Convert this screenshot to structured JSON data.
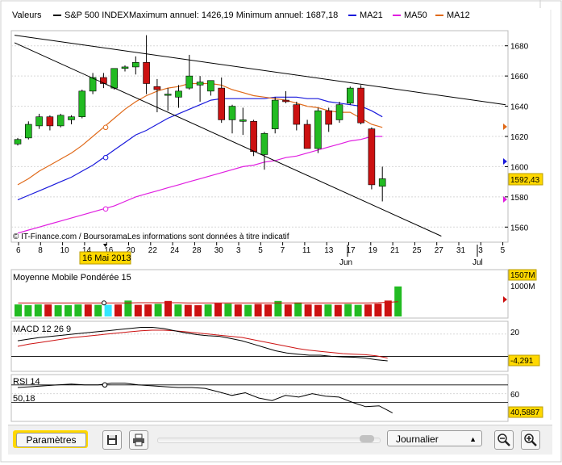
{
  "header": {
    "valeurs_label": "Valeurs",
    "index_name": "S&P 500 INDEX",
    "max_min_text": "Maximum annuel: 1426,19 Minimum annuel: 1687,18",
    "legend": [
      {
        "name": "MA21",
        "color": "#1a1adc"
      },
      {
        "name": "MA50",
        "color": "#e01ee0"
      },
      {
        "name": "MA12",
        "color": "#e06a1a"
      }
    ]
  },
  "copyright": "© IT-Finance.com / BoursoramaLes informations sont données à titre indicatif",
  "date_highlight": "16 Mai 2013",
  "price_badge": "1592,43",
  "colors": {
    "up": "#22bb22",
    "down": "#cc1111",
    "highlight": "#ffd800",
    "trendline": "#000000"
  },
  "chart_data": [
    {
      "type": "candlestick",
      "ylim": [
        1550,
        1690
      ],
      "y_ticks": [
        "1560",
        "1580",
        "1600",
        "1620",
        "1640",
        "1660",
        "1680"
      ],
      "x_tick_labels": [
        "6",
        "8",
        "10",
        "14",
        "16",
        "20",
        "22",
        "24",
        "28",
        "30",
        "3",
        "5",
        "7",
        "11",
        "13",
        "17",
        "19",
        "21",
        "25",
        "27",
        "31",
        "3",
        "5"
      ],
      "x_month_labels": [
        "Jun",
        "Jul"
      ],
      "candles": [
        {
          "o": 1615,
          "h": 1619,
          "l": 1614,
          "c": 1618
        },
        {
          "o": 1619,
          "h": 1630,
          "l": 1618,
          "c": 1628
        },
        {
          "o": 1627,
          "h": 1635,
          "l": 1625,
          "c": 1633
        },
        {
          "o": 1633,
          "h": 1634,
          "l": 1624,
          "c": 1627
        },
        {
          "o": 1627,
          "h": 1635,
          "l": 1626,
          "c": 1634
        },
        {
          "o": 1631,
          "h": 1634,
          "l": 1628,
          "c": 1633
        },
        {
          "o": 1633,
          "h": 1651,
          "l": 1632,
          "c": 1650
        },
        {
          "o": 1650,
          "h": 1662,
          "l": 1648,
          "c": 1659
        },
        {
          "o": 1659,
          "h": 1662,
          "l": 1652,
          "c": 1655
        },
        {
          "o": 1652,
          "h": 1665,
          "l": 1651,
          "c": 1665
        },
        {
          "o": 1665,
          "h": 1667,
          "l": 1663,
          "c": 1666
        },
        {
          "o": 1666,
          "h": 1673,
          "l": 1661,
          "c": 1669
        },
        {
          "o": 1669,
          "h": 1687,
          "l": 1648,
          "c": 1655
        },
        {
          "o": 1653,
          "h": 1658,
          "l": 1636,
          "c": 1651
        },
        {
          "o": 1648,
          "h": 1652,
          "l": 1637,
          "c": 1648
        },
        {
          "o": 1646,
          "h": 1654,
          "l": 1639,
          "c": 1650
        },
        {
          "o": 1652,
          "h": 1674,
          "l": 1651,
          "c": 1660
        },
        {
          "o": 1654,
          "h": 1660,
          "l": 1643,
          "c": 1656
        },
        {
          "o": 1650,
          "h": 1657,
          "l": 1647,
          "c": 1657
        },
        {
          "o": 1652,
          "h": 1659,
          "l": 1629,
          "c": 1631
        },
        {
          "o": 1631,
          "h": 1641,
          "l": 1622,
          "c": 1640
        },
        {
          "o": 1630,
          "h": 1639,
          "l": 1621,
          "c": 1631
        },
        {
          "o": 1630,
          "h": 1631,
          "l": 1607,
          "c": 1610
        },
        {
          "o": 1608,
          "h": 1623,
          "l": 1598,
          "c": 1622
        },
        {
          "o": 1625,
          "h": 1646,
          "l": 1622,
          "c": 1644
        },
        {
          "o": 1644,
          "h": 1650,
          "l": 1642,
          "c": 1643
        },
        {
          "o": 1641,
          "h": 1643,
          "l": 1624,
          "c": 1628
        },
        {
          "o": 1628,
          "h": 1631,
          "l": 1613,
          "c": 1612
        },
        {
          "o": 1612,
          "h": 1639,
          "l": 1609,
          "c": 1637
        },
        {
          "o": 1637,
          "h": 1639,
          "l": 1623,
          "c": 1628
        },
        {
          "o": 1631,
          "h": 1643,
          "l": 1629,
          "c": 1641
        },
        {
          "o": 1642,
          "h": 1653,
          "l": 1641,
          "c": 1652
        },
        {
          "o": 1652,
          "h": 1654,
          "l": 1628,
          "c": 1629
        },
        {
          "o": 1625,
          "h": 1626,
          "l": 1585,
          "c": 1588
        },
        {
          "o": 1587,
          "h": 1600,
          "l": 1577,
          "c": 1592
        }
      ],
      "ma12": [
        1588,
        1592,
        1597,
        1601,
        1605,
        1609,
        1614,
        1620,
        1626,
        1632,
        1638,
        1643,
        1647,
        1650,
        1652,
        1653,
        1655,
        1655,
        1655,
        1654,
        1651,
        1649,
        1647,
        1646,
        1645,
        1644,
        1642,
        1640,
        1639,
        1637,
        1636,
        1636,
        1632,
        1628,
        1626
      ],
      "ma21": [
        1578,
        1581,
        1584,
        1587,
        1590,
        1593,
        1597,
        1601,
        1606,
        1611,
        1616,
        1621,
        1624,
        1628,
        1632,
        1635,
        1638,
        1641,
        1644,
        1645,
        1645,
        1645,
        1645,
        1645,
        1646,
        1646,
        1646,
        1645,
        1645,
        1643,
        1642,
        1641,
        1640,
        1637,
        1633
      ],
      "ma50": [
        1556,
        1558,
        1560,
        1562,
        1564,
        1566,
        1568,
        1570,
        1572,
        1574,
        1577,
        1580,
        1582,
        1584,
        1586,
        1588,
        1590,
        1592,
        1594,
        1596,
        1598,
        1600,
        1601,
        1603,
        1604,
        1606,
        1607,
        1609,
        1611,
        1613,
        1615,
        1617,
        1618,
        1620,
        1620
      ],
      "trendlines": [
        {
          "from": {
            "index": -0.3,
            "value": 1687
          },
          "to": {
            "index": 45.5,
            "value": 1641
          }
        },
        {
          "from": {
            "index": -0.3,
            "value": 1682
          },
          "to": {
            "index": 39.5,
            "value": 1554
          }
        }
      ]
    },
    {
      "type": "bar",
      "title": "Moyenne Mobile Pondérée 15",
      "badge": "1507M",
      "y_tick": "1000M",
      "values": [
        0.62,
        0.58,
        0.62,
        0.62,
        0.58,
        0.58,
        0.62,
        0.62,
        0.6,
        0.6,
        0.62,
        0.82,
        0.6,
        0.62,
        0.65,
        0.8,
        0.62,
        0.6,
        0.58,
        0.62,
        0.68,
        0.66,
        0.62,
        0.6,
        0.64,
        0.62,
        0.8,
        0.62,
        0.72,
        0.62,
        0.6,
        0.62,
        0.6,
        0.64,
        0.6,
        0.62,
        0.66,
        0.82,
        1.55
      ],
      "colors": [
        "up",
        "up",
        "up",
        "down",
        "up",
        "up",
        "up",
        "down",
        "up",
        "highlight",
        "down",
        "up",
        "down",
        "down",
        "up",
        "down",
        "up",
        "down",
        "down",
        "up",
        "down",
        "up",
        "down",
        "up",
        "down",
        "down",
        "up",
        "down",
        "up",
        "down",
        "down",
        "up",
        "down",
        "up",
        "up",
        "down",
        "down",
        "down",
        "up"
      ],
      "ma_line": [
        0.7,
        0.7,
        0.7,
        0.7,
        0.7,
        0.7,
        0.7,
        0.7,
        0.7,
        0.7,
        0.7,
        0.7,
        0.71,
        0.71,
        0.71,
        0.71,
        0.71,
        0.7,
        0.7,
        0.7,
        0.7,
        0.7,
        0.7,
        0.7,
        0.7,
        0.7,
        0.7,
        0.7,
        0.7,
        0.7,
        0.7,
        0.7,
        0.7,
        0.7,
        0.7,
        0.7,
        0.71,
        0.73,
        0.76
      ]
    },
    {
      "type": "line",
      "title": "MACD 12 26 9",
      "badge": "-4,291",
      "y_tick": "20",
      "ylim": [
        -12,
        30
      ],
      "macd": [
        14,
        15.5,
        17,
        18,
        19,
        20,
        21,
        22,
        23,
        24,
        25,
        26,
        26,
        25,
        23,
        21,
        19.5,
        18.5,
        18,
        16,
        14,
        11,
        8,
        5,
        3,
        2,
        1,
        1,
        0,
        -0.5,
        -0.8,
        -1.5,
        -3,
        -4
      ],
      "signal": [
        9,
        11,
        12.5,
        14,
        15.5,
        17,
        18,
        19,
        20,
        21,
        22,
        23,
        23.5,
        23.5,
        23,
        22,
        21,
        20,
        19,
        18,
        17,
        15,
        13,
        11,
        9,
        7,
        5.5,
        4.5,
        3.5,
        2.5,
        2,
        1.5,
        0.5,
        -1.5
      ]
    },
    {
      "type": "line",
      "title": "RSI 14",
      "value_label": "50,18",
      "badge": "40,5887",
      "y_tick": "60",
      "ylim": [
        30,
        80
      ],
      "rsi": [
        67,
        68,
        69,
        70,
        71,
        70,
        70,
        72,
        72,
        70,
        69,
        68,
        67,
        67,
        66,
        62,
        58,
        61,
        55,
        52,
        58,
        56,
        60,
        57,
        56,
        50,
        45,
        46,
        38
      ]
    }
  ],
  "toolbar": {
    "params_label": "Paramètres",
    "period_label": "Journalier"
  }
}
